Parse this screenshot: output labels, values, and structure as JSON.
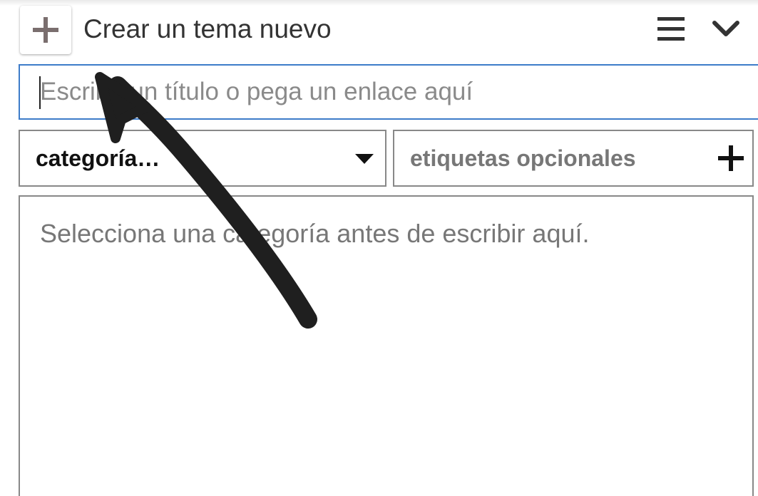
{
  "header": {
    "new_topic_icon": "plus-icon",
    "title": "Crear un tema nuevo",
    "menu_icon": "hamburger-menu-icon",
    "collapse_icon": "chevron-down-icon"
  },
  "title_field": {
    "value": "",
    "placeholder": "Escribe un título o pega un enlace aquí"
  },
  "category": {
    "selected": "categoría…",
    "icon": "caret-down-icon"
  },
  "tags": {
    "placeholder": "etiquetas opcionales",
    "icon": "plus-icon"
  },
  "editor": {
    "placeholder": "Selecciona una categoría antes de escribir aquí."
  },
  "colors": {
    "focus_border": "#3d7cc9",
    "arrow": "#1f1f1f"
  }
}
